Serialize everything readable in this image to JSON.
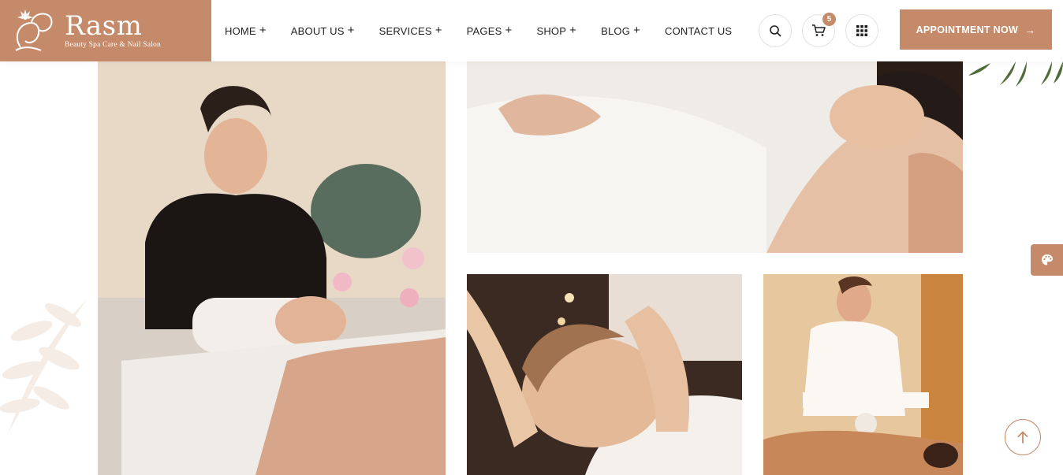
{
  "brand": {
    "name": "Rasm",
    "tagline": "Beauty Spa Care & Nail Salon",
    "accent_color": "#c48a6a"
  },
  "nav": {
    "items": [
      {
        "label": "HOME",
        "has_submenu": true
      },
      {
        "label": "ABOUT US",
        "has_submenu": true
      },
      {
        "label": "SERVICES",
        "has_submenu": true
      },
      {
        "label": "PAGES",
        "has_submenu": true
      },
      {
        "label": "SHOP",
        "has_submenu": true
      },
      {
        "label": "BLOG",
        "has_submenu": true
      },
      {
        "label": "CONTACT US",
        "has_submenu": false
      }
    ],
    "submenu_symbol": "+"
  },
  "header_actions": {
    "search_icon": "search-icon",
    "cart_icon": "cart-icon",
    "cart_count": "5",
    "menu_icon": "grid-menu-icon",
    "appointment_label": "APPOINTMENT NOW",
    "appointment_arrow": "→"
  },
  "gallery": {
    "images": [
      {
        "name": "therapist-facial-massage",
        "icon": "photo"
      },
      {
        "name": "woman-in-bathrobe-head-massage",
        "icon": "photo"
      },
      {
        "name": "face-massage-closeup",
        "icon": "photo"
      },
      {
        "name": "therapist-back-massage",
        "icon": "photo"
      }
    ]
  },
  "widgets": {
    "palette_icon": "palette-icon",
    "scroll_top_icon": "arrow-up-icon"
  }
}
